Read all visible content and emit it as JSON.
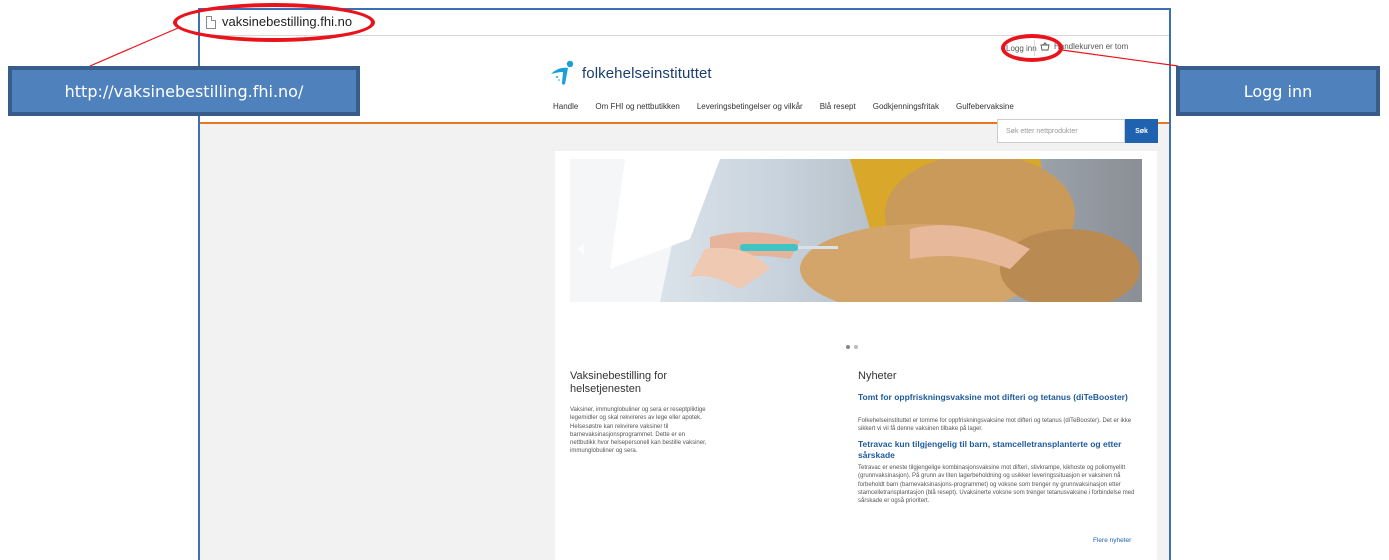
{
  "browser": {
    "url": "vaksinebestilling.fhi.no"
  },
  "header": {
    "login": "Logg inn",
    "cart": "Handlekurven er tom",
    "logo_text": "folkehelseinstituttet"
  },
  "nav": {
    "items": [
      "Handle",
      "Om FHI og nettbutikken",
      "Leveringsbetingelser og vilkår",
      "Blå resept",
      "Godkjenningsfritak",
      "Gulfebervaksine"
    ]
  },
  "search": {
    "placeholder": "Søk etter nettprodukter",
    "button": "Søk"
  },
  "intro": {
    "title": "Vaksinebestilling for helsetjenesten",
    "body": "Vaksiner, immunglobuliner og sera er reseptpliktige legemidler og skal rekvireres av lege eller apotek. Helsesøstre kan rekvirere vaksiner til barnevaksinasjonsprogrammet. Dette er en nettbutikk hvor helsepersonell kan bestille vaksiner, immunglobuliner og sera."
  },
  "news": {
    "title": "Nyheter",
    "items": [
      {
        "headline": "Tomt for oppfriskningsvaksine mot difteri og tetanus (diTeBooster)",
        "body": "Folkehelseinstituttet er tomme for oppfriskningsvaksine mot difteri og tetanus (diTeBooster). Det er ikke sikkert vi vil få denne vaksinen tilbake på lager."
      },
      {
        "headline": "Tetravac kun tilgjengelig til barn, stamcelletransplanterte og etter sårskade",
        "body": "Tetravac er eneste tilgjengelige kombinasjonsvaksine mot difteri, stivkrampe, kikhoste og poliomyelitt (grunnvaksinasjon). På grunn av liten lagerbeholdning og usikker leveringssituasjon er vaksinen nå forbeholdt barn (barnevaksinasjons-programmet) og voksne som trenger ny grunnvaksinasjon etter stamcelletransplantasjon (blå resept). Uvaksinerte voksne som trenger tetanusvaksine i forbindelse med sårskade er også prioritert."
      }
    ],
    "more": "Flere nyheter"
  },
  "annotations": {
    "url_callout": "http://vaksinebestilling.fhi.no/",
    "login_callout": "Logg inn",
    "highlight_color": "#e8131b",
    "callout_color": "#4f81bd"
  },
  "colors": {
    "brand_blue": "#1e62b0",
    "accent_orange": "#e87722"
  }
}
